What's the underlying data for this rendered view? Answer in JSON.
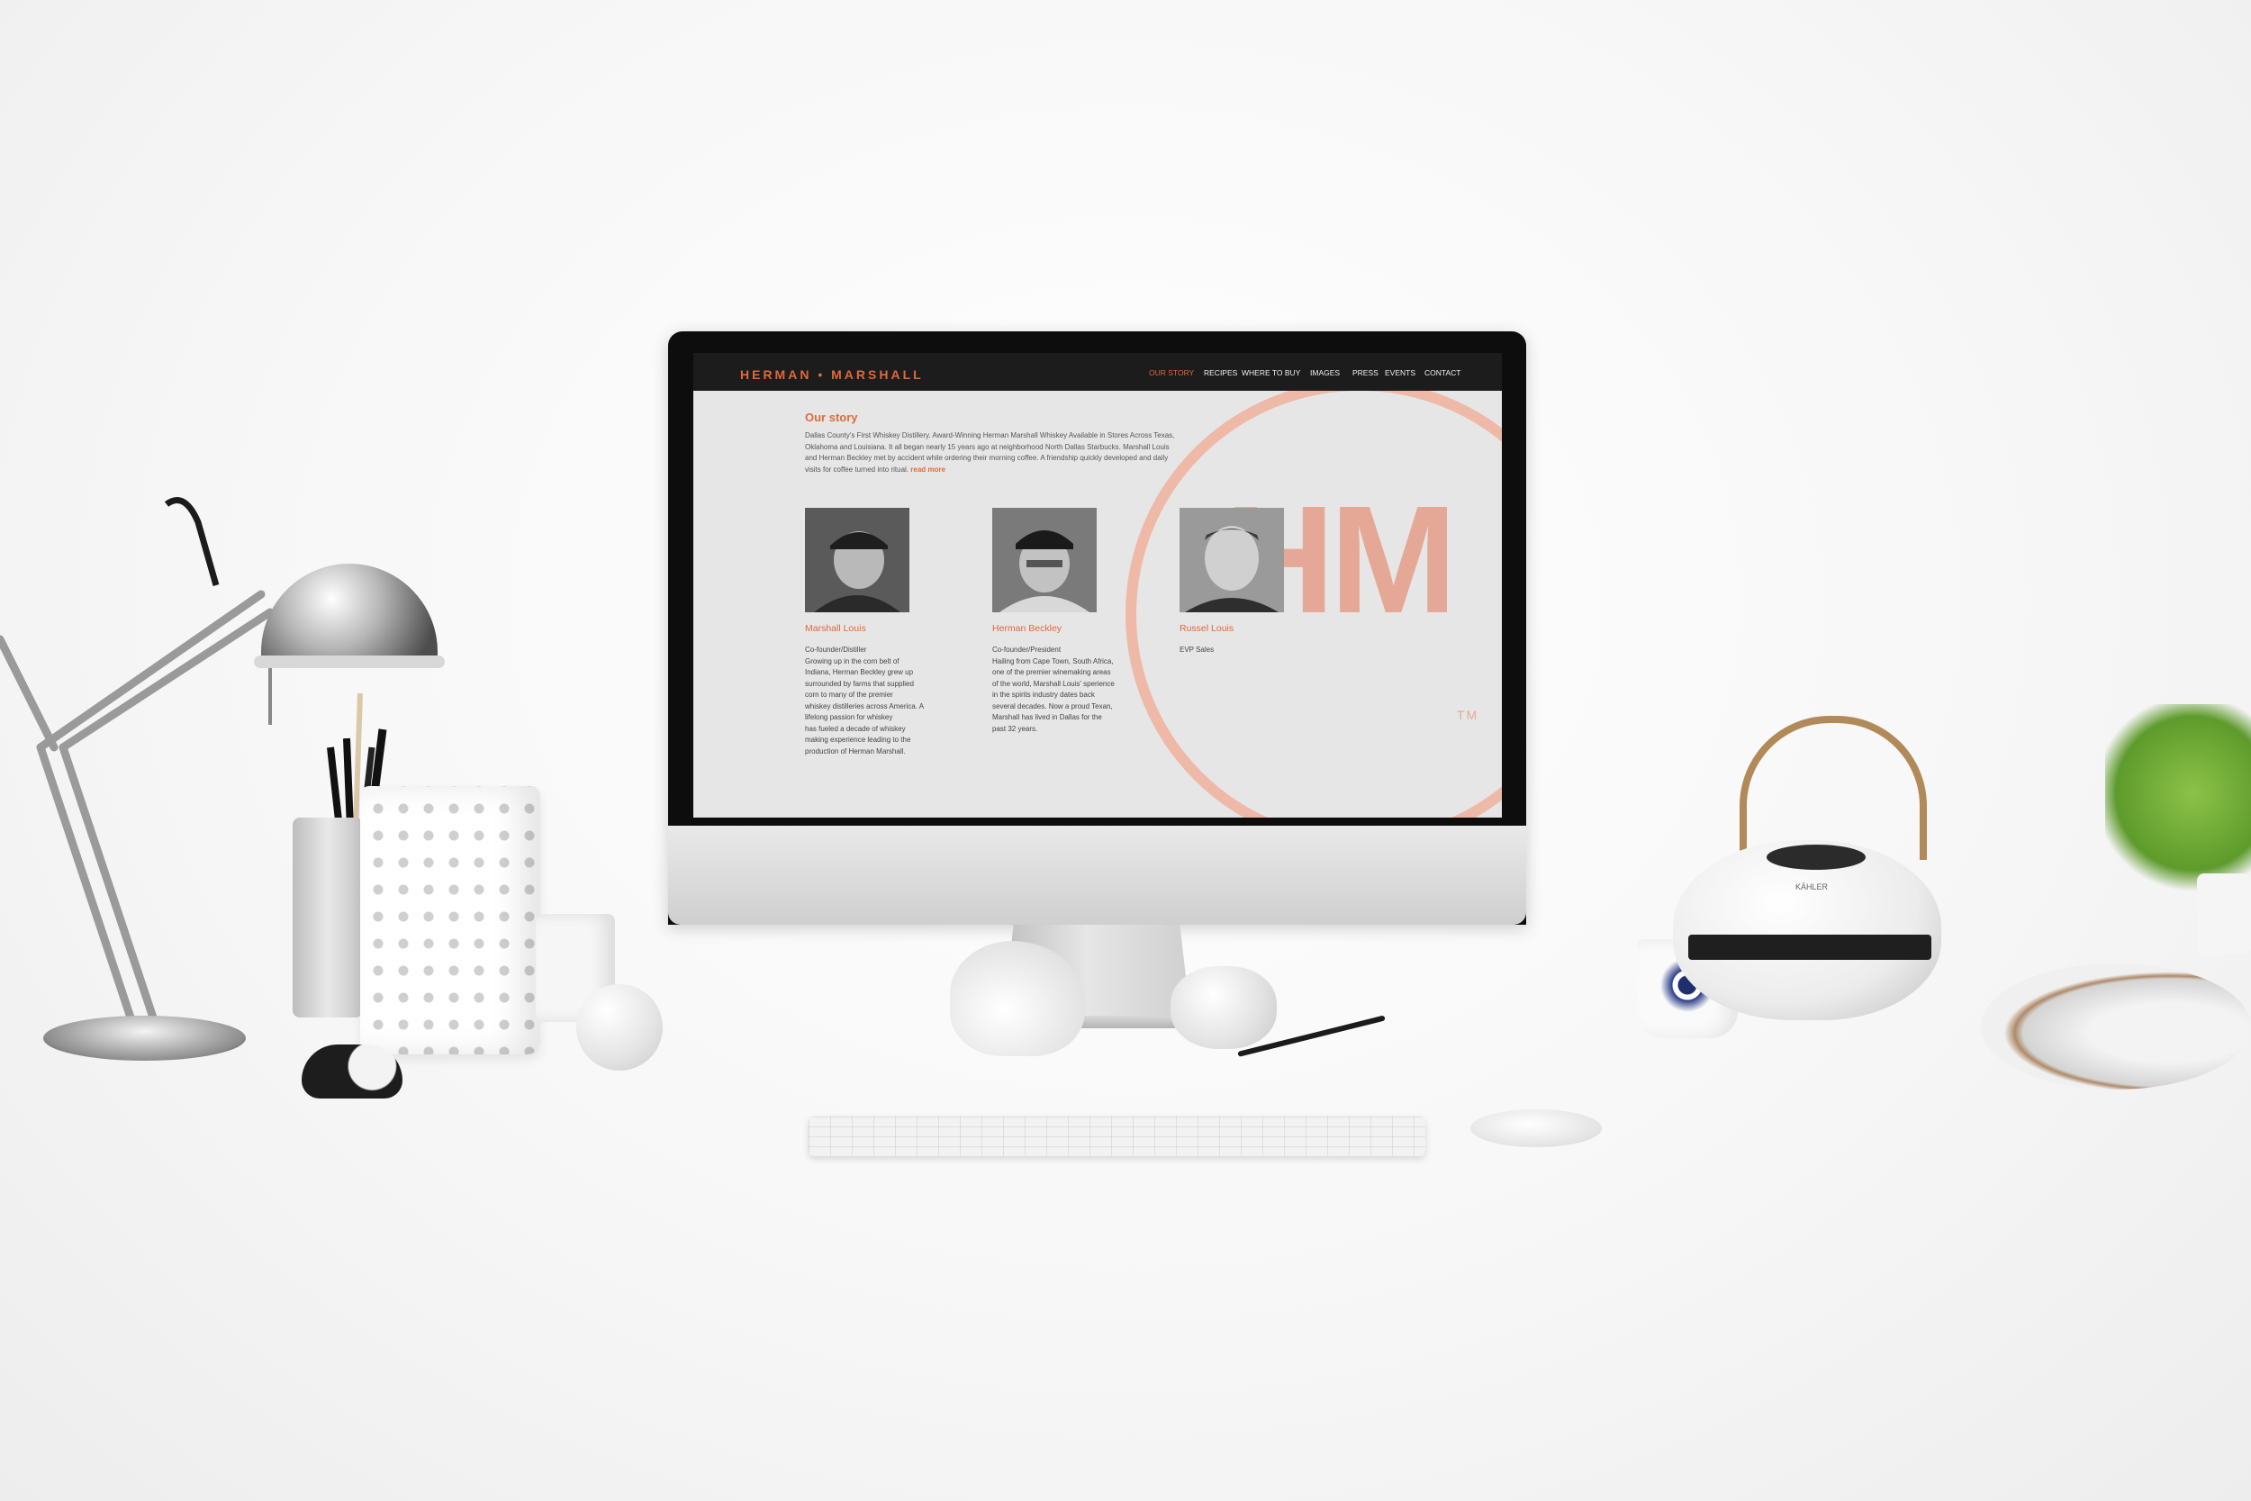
{
  "site": {
    "logo": "HERMAN • MARSHALL",
    "nav": [
      "OUR STORY",
      "RECIPES",
      "WHERE TO BUY",
      "IMAGES",
      "PRESS",
      "EVENTS",
      "CONTACT"
    ],
    "active_nav": "OUR STORY",
    "accent_color": "#e0683a",
    "watermark": {
      "mark": "HM",
      "tm": "TM",
      "color": "#e6a896"
    }
  },
  "story": {
    "heading": "Our story",
    "body": "Dallas County's First Whiskey Distillery. Award-Winning Herman Marshall Whiskey Available in Stores Across Texas, Oklahoma and Louisiana. It all began nearly 15 years ago at neighborhood North Dallas Starbucks. Marshall Louis and Herman Beckley met by accident while ordering their morning coffee. A friendship quickly developed and daily visits for coffee turned into ritual.",
    "read_more": "read more"
  },
  "people": [
    {
      "name": "Marshall Louis",
      "bio": "Co-founder/Distiller\nGrowing up in the corn belt of\nIndiana, Herman Beckley grew up\nsurrounded by farms that supplied\ncorn to many of the premier\nwhiskey distilleries across America. A\nlifelong passion for whiskey\nhas fueled a decade of whiskey\nmaking experience leading to the\nproduction of Herman Marshall."
    },
    {
      "name": "Herman Beckley",
      "bio": "Co-founder/President\nHailing from Cape Town, South Africa,\none of the premier winemaking areas\nof the world, Marshall Louis' sperience\nin the spirits industry dates back\nseveral decades. Now a proud Texan,\nMarshall has lived in Dallas for the\npast 32 years."
    },
    {
      "name": "Russel Louis",
      "bio": "EVP Sales"
    }
  ],
  "device": {
    "apple_logo": "",
    "teapot_brand": "KÄHLER"
  }
}
